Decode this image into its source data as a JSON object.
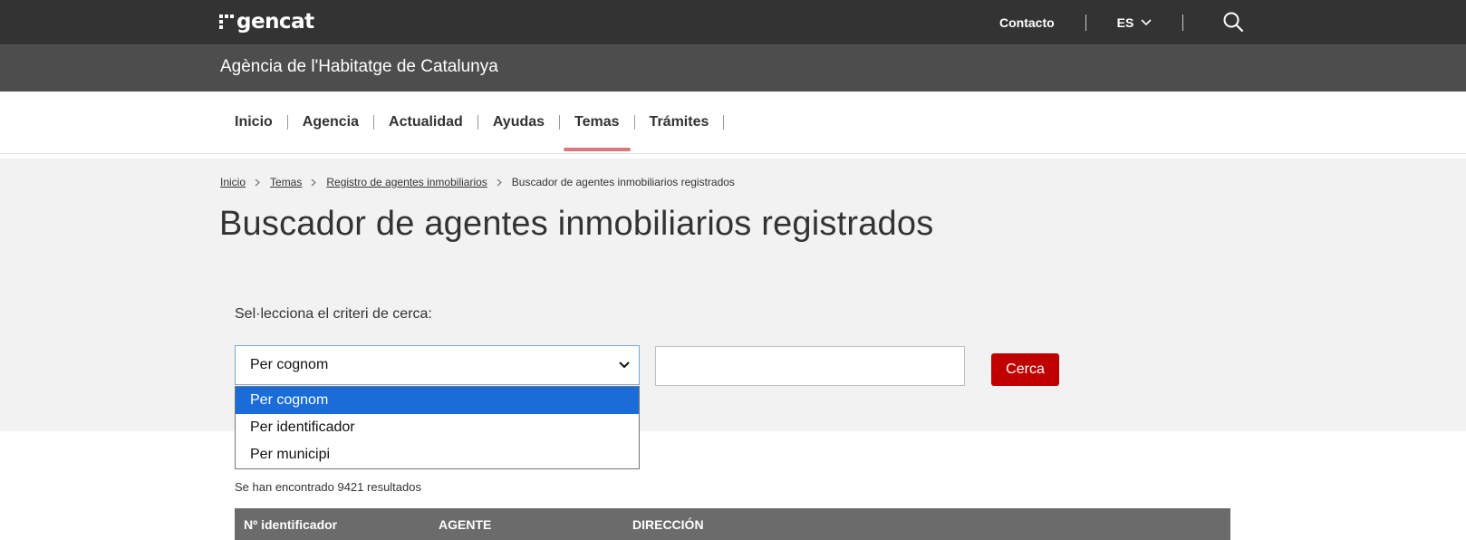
{
  "header": {
    "logo_text": "gencat",
    "contact": "Contacto",
    "language": "ES",
    "icons": {
      "search": "search-icon",
      "language_chevron": "chevron-down-icon"
    }
  },
  "agency": {
    "title": "Agència de l'Habitatge de Catalunya"
  },
  "nav": {
    "items": [
      {
        "label": "Inicio"
      },
      {
        "label": "Agencia"
      },
      {
        "label": "Actualidad"
      },
      {
        "label": "Ayudas"
      },
      {
        "label": "Temas",
        "active": true
      },
      {
        "label": "Trámites"
      }
    ],
    "active_color": "#d9777a"
  },
  "breadcrumb": [
    {
      "label": "Inicio",
      "link": true
    },
    {
      "label": "Temas",
      "link": true
    },
    {
      "label": "Registro de agentes inmobiliarios",
      "link": true
    },
    {
      "label": "Buscador de agentes inmobiliarios registrados",
      "link": false
    }
  ],
  "page": {
    "title": "Buscador de agentes inmobiliarios registrados"
  },
  "search": {
    "label": "Sel·lecciona el criteri de cerca:",
    "selected": "Per cognom",
    "options": [
      "Per cognom",
      "Per identificador",
      "Per municipi"
    ],
    "input_value": "",
    "button": "Cerca",
    "button_color": "#c00000"
  },
  "results": {
    "text": "Se han encontrado 9421 resultados",
    "columns": [
      "Nº identificador",
      "AGENTE",
      "DIRECCIÓN"
    ]
  }
}
